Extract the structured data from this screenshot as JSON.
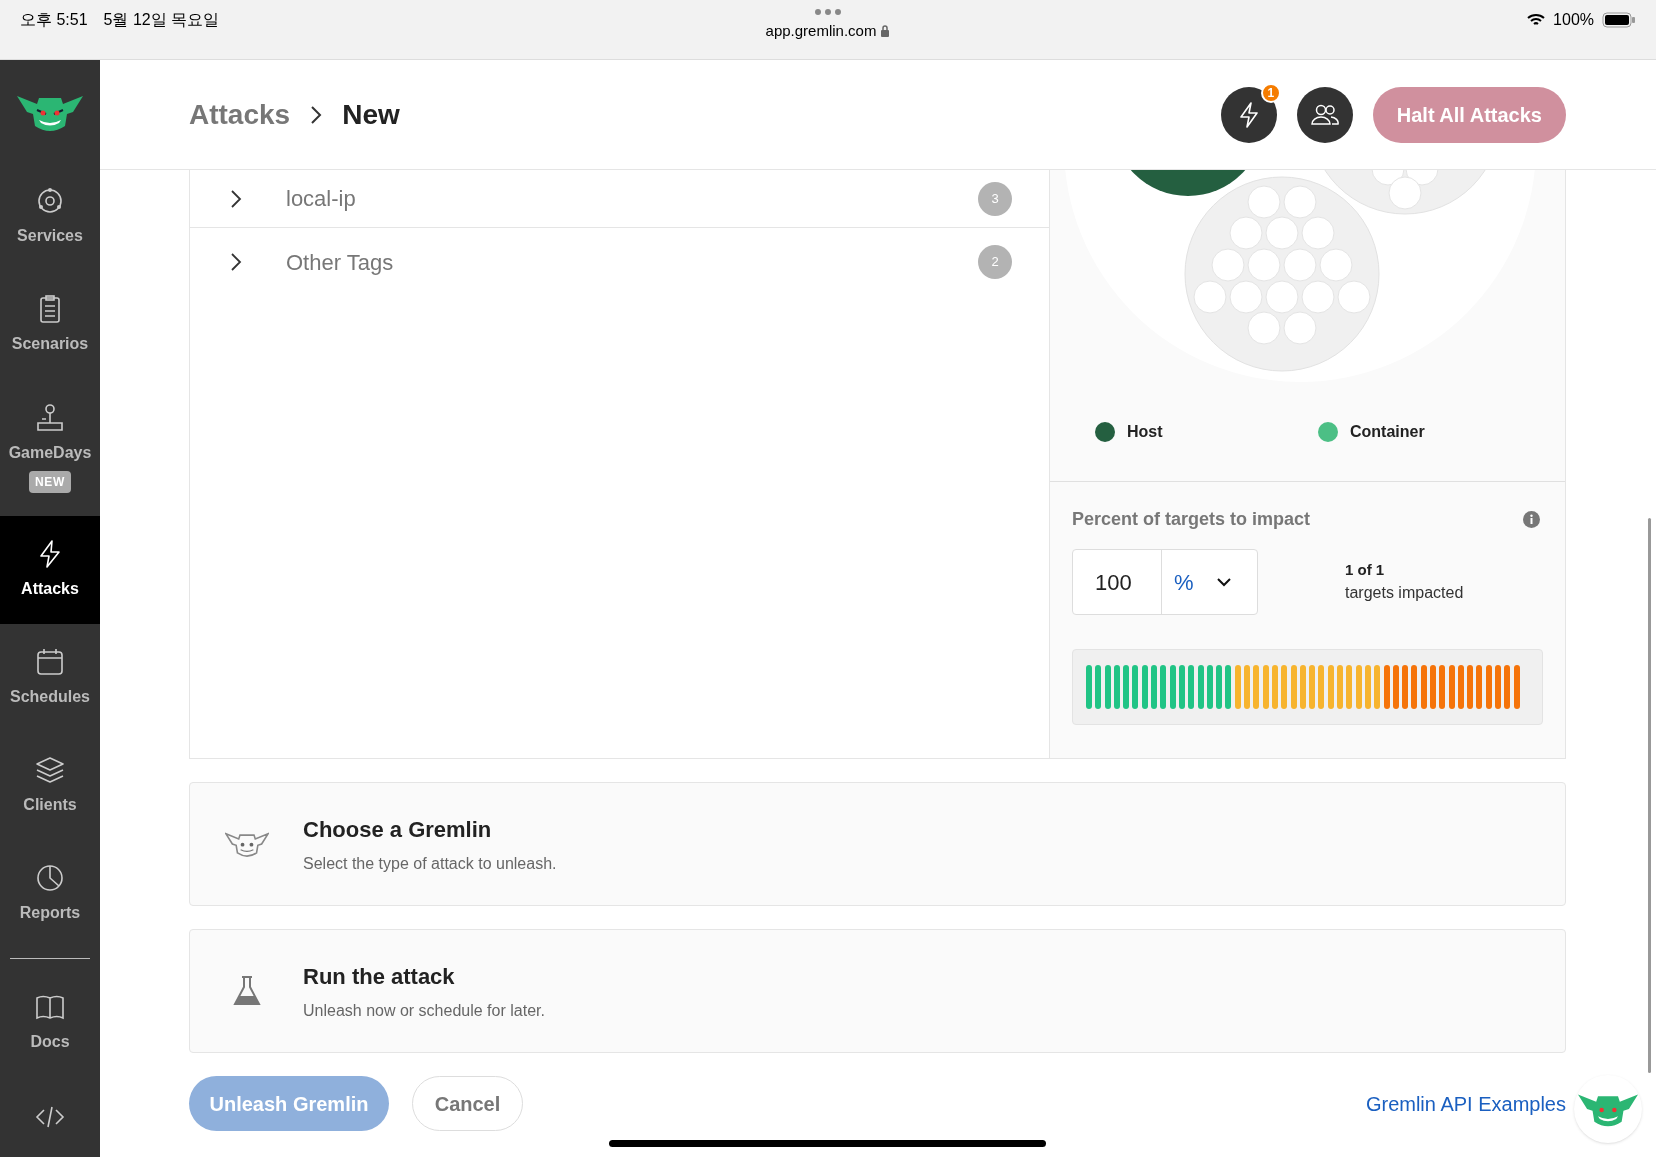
{
  "status_bar": {
    "time": "오후 5:51",
    "date": "5월 12일 목요일",
    "url": "app.gremlin.com",
    "battery": "100%"
  },
  "sidebar": {
    "items": [
      {
        "kind": "services",
        "label": "Services",
        "selected": false
      },
      {
        "kind": "scenarios",
        "label": "Scenarios",
        "selected": false
      },
      {
        "kind": "gamedays",
        "label": "GameDays",
        "badge": "NEW",
        "selected": false
      },
      {
        "kind": "attacks",
        "label": "Attacks",
        "selected": true
      },
      {
        "kind": "schedules",
        "label": "Schedules",
        "selected": false
      },
      {
        "kind": "clients",
        "label": "Clients",
        "selected": false
      },
      {
        "kind": "reports",
        "label": "Reports",
        "selected": false
      },
      {
        "kind": "docs",
        "label": "Docs",
        "selected": false
      },
      {
        "kind": "code",
        "selected": false
      }
    ]
  },
  "header": {
    "breadcrumb": [
      "Attacks",
      "New"
    ],
    "notification_count": "1",
    "halt_button": "Halt All Attacks"
  },
  "tag_list": [
    {
      "label": "local-ip",
      "count": "3"
    },
    {
      "label": "Other Tags",
      "count": "2"
    }
  ],
  "target_chart": {
    "legend": [
      {
        "label": "Host",
        "color": "#245f40"
      },
      {
        "label": "Container",
        "color": "#4cbf85"
      }
    ]
  },
  "impact": {
    "title": "Percent of targets to impact",
    "value": "100",
    "unit": "%",
    "summary_count": "1 of 1",
    "summary": "targets impacted"
  },
  "steps": [
    {
      "kind": "gremlin",
      "title": "Choose a Gremlin",
      "subtitle": "Select the type of attack to unleash."
    },
    {
      "kind": "flask",
      "title": "Run the attack",
      "subtitle": "Unleash now or schedule for later."
    }
  ],
  "actions": {
    "primary": "Unleash Gremlin",
    "primary_disabled": true,
    "secondary": "Cancel",
    "link": "Gremlin API Examples"
  }
}
